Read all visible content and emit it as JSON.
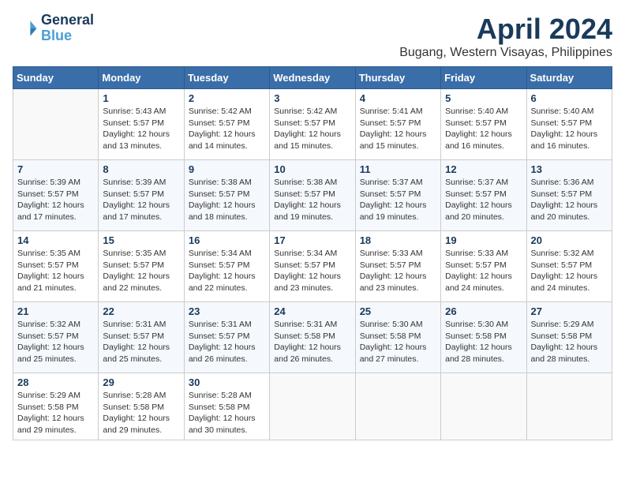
{
  "logo": {
    "line1": "General",
    "line2": "Blue"
  },
  "title": "April 2024",
  "location": "Bugang, Western Visayas, Philippines",
  "days_header": [
    "Sunday",
    "Monday",
    "Tuesday",
    "Wednesday",
    "Thursday",
    "Friday",
    "Saturday"
  ],
  "weeks": [
    [
      {
        "day": "",
        "info": ""
      },
      {
        "day": "1",
        "info": "Sunrise: 5:43 AM\nSunset: 5:57 PM\nDaylight: 12 hours\nand 13 minutes."
      },
      {
        "day": "2",
        "info": "Sunrise: 5:42 AM\nSunset: 5:57 PM\nDaylight: 12 hours\nand 14 minutes."
      },
      {
        "day": "3",
        "info": "Sunrise: 5:42 AM\nSunset: 5:57 PM\nDaylight: 12 hours\nand 15 minutes."
      },
      {
        "day": "4",
        "info": "Sunrise: 5:41 AM\nSunset: 5:57 PM\nDaylight: 12 hours\nand 15 minutes."
      },
      {
        "day": "5",
        "info": "Sunrise: 5:40 AM\nSunset: 5:57 PM\nDaylight: 12 hours\nand 16 minutes."
      },
      {
        "day": "6",
        "info": "Sunrise: 5:40 AM\nSunset: 5:57 PM\nDaylight: 12 hours\nand 16 minutes."
      }
    ],
    [
      {
        "day": "7",
        "info": "Sunrise: 5:39 AM\nSunset: 5:57 PM\nDaylight: 12 hours\nand 17 minutes."
      },
      {
        "day": "8",
        "info": "Sunrise: 5:39 AM\nSunset: 5:57 PM\nDaylight: 12 hours\nand 17 minutes."
      },
      {
        "day": "9",
        "info": "Sunrise: 5:38 AM\nSunset: 5:57 PM\nDaylight: 12 hours\nand 18 minutes."
      },
      {
        "day": "10",
        "info": "Sunrise: 5:38 AM\nSunset: 5:57 PM\nDaylight: 12 hours\nand 19 minutes."
      },
      {
        "day": "11",
        "info": "Sunrise: 5:37 AM\nSunset: 5:57 PM\nDaylight: 12 hours\nand 19 minutes."
      },
      {
        "day": "12",
        "info": "Sunrise: 5:37 AM\nSunset: 5:57 PM\nDaylight: 12 hours\nand 20 minutes."
      },
      {
        "day": "13",
        "info": "Sunrise: 5:36 AM\nSunset: 5:57 PM\nDaylight: 12 hours\nand 20 minutes."
      }
    ],
    [
      {
        "day": "14",
        "info": "Sunrise: 5:35 AM\nSunset: 5:57 PM\nDaylight: 12 hours\nand 21 minutes."
      },
      {
        "day": "15",
        "info": "Sunrise: 5:35 AM\nSunset: 5:57 PM\nDaylight: 12 hours\nand 22 minutes."
      },
      {
        "day": "16",
        "info": "Sunrise: 5:34 AM\nSunset: 5:57 PM\nDaylight: 12 hours\nand 22 minutes."
      },
      {
        "day": "17",
        "info": "Sunrise: 5:34 AM\nSunset: 5:57 PM\nDaylight: 12 hours\nand 23 minutes."
      },
      {
        "day": "18",
        "info": "Sunrise: 5:33 AM\nSunset: 5:57 PM\nDaylight: 12 hours\nand 23 minutes."
      },
      {
        "day": "19",
        "info": "Sunrise: 5:33 AM\nSunset: 5:57 PM\nDaylight: 12 hours\nand 24 minutes."
      },
      {
        "day": "20",
        "info": "Sunrise: 5:32 AM\nSunset: 5:57 PM\nDaylight: 12 hours\nand 24 minutes."
      }
    ],
    [
      {
        "day": "21",
        "info": "Sunrise: 5:32 AM\nSunset: 5:57 PM\nDaylight: 12 hours\nand 25 minutes."
      },
      {
        "day": "22",
        "info": "Sunrise: 5:31 AM\nSunset: 5:57 PM\nDaylight: 12 hours\nand 25 minutes."
      },
      {
        "day": "23",
        "info": "Sunrise: 5:31 AM\nSunset: 5:57 PM\nDaylight: 12 hours\nand 26 minutes."
      },
      {
        "day": "24",
        "info": "Sunrise: 5:31 AM\nSunset: 5:58 PM\nDaylight: 12 hours\nand 26 minutes."
      },
      {
        "day": "25",
        "info": "Sunrise: 5:30 AM\nSunset: 5:58 PM\nDaylight: 12 hours\nand 27 minutes."
      },
      {
        "day": "26",
        "info": "Sunrise: 5:30 AM\nSunset: 5:58 PM\nDaylight: 12 hours\nand 28 minutes."
      },
      {
        "day": "27",
        "info": "Sunrise: 5:29 AM\nSunset: 5:58 PM\nDaylight: 12 hours\nand 28 minutes."
      }
    ],
    [
      {
        "day": "28",
        "info": "Sunrise: 5:29 AM\nSunset: 5:58 PM\nDaylight: 12 hours\nand 29 minutes."
      },
      {
        "day": "29",
        "info": "Sunrise: 5:28 AM\nSunset: 5:58 PM\nDaylight: 12 hours\nand 29 minutes."
      },
      {
        "day": "30",
        "info": "Sunrise: 5:28 AM\nSunset: 5:58 PM\nDaylight: 12 hours\nand 30 minutes."
      },
      {
        "day": "",
        "info": ""
      },
      {
        "day": "",
        "info": ""
      },
      {
        "day": "",
        "info": ""
      },
      {
        "day": "",
        "info": ""
      }
    ]
  ]
}
